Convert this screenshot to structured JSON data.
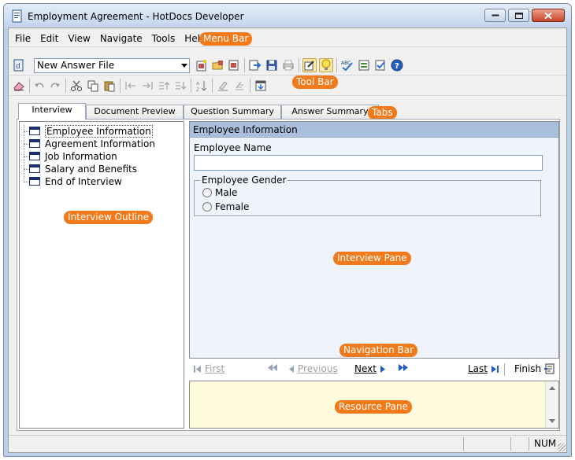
{
  "window": {
    "title": "Employment Agreement - HotDocs Developer"
  },
  "menu": {
    "items": [
      "File",
      "Edit",
      "View",
      "Navigate",
      "Tools",
      "Help"
    ]
  },
  "toolbar": {
    "answer_file": "New Answer File"
  },
  "tabs": [
    {
      "label": "Interview",
      "active": true
    },
    {
      "label": "Document Preview",
      "active": false
    },
    {
      "label": "Question Summary",
      "active": false
    },
    {
      "label": "Answer Summary",
      "active": false
    }
  ],
  "outline": {
    "items": [
      "Employee Information",
      "Agreement Information",
      "Job Information",
      "Salary and Benefits",
      "End of Interview"
    ]
  },
  "interview": {
    "header": "Employee Information",
    "name_label": "Employee Name",
    "name_value": "",
    "gender_label": "Employee Gender",
    "gender_options": [
      "Male",
      "Female"
    ]
  },
  "navigation": {
    "first": "First",
    "previous": "Previous",
    "next": "Next",
    "last": "Last",
    "finish": "Finish"
  },
  "status": {
    "num": "NUM"
  },
  "callouts": {
    "menu_bar": "Menu Bar",
    "tool_bar": "Tool Bar",
    "tabs": "Tabs",
    "interview_outline": "Interview Outline",
    "interview_pane": "Interview Pane",
    "navigation_bar": "Navigation Bar",
    "resource_pane": "Resource Pane"
  },
  "colors": {
    "callout": "#f27a1a",
    "resource_bg": "#fffbdd",
    "pane_header": "#a9bfdb"
  }
}
